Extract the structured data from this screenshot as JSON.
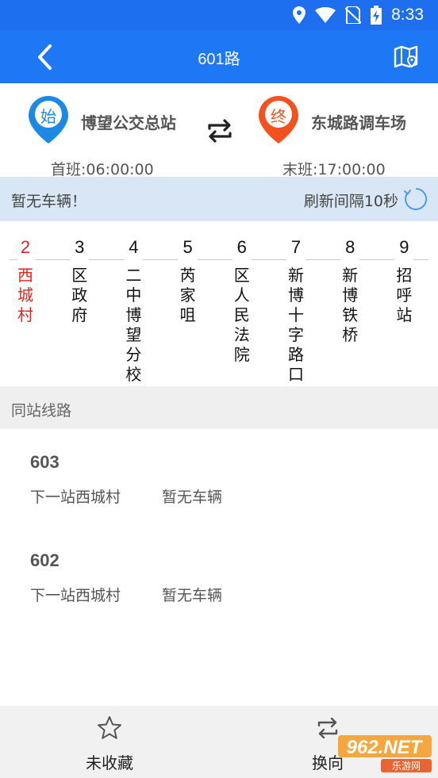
{
  "status_bar": {
    "time": "8:33",
    "icons": [
      "location-icon",
      "wifi-icon",
      "no-sim-icon",
      "battery-charging-icon"
    ]
  },
  "header": {
    "title": "601路",
    "back_icon": "chevron-left-icon",
    "map_icon": "map-icon"
  },
  "route": {
    "start": {
      "badge": "始",
      "name": "博望公交总站",
      "time": "首班:06:00:00",
      "color": "#1E88E5"
    },
    "end": {
      "badge": "终",
      "name": "东城路调车场",
      "time": "末班:17:00:00",
      "color": "#F4511E"
    },
    "swap_icon": "swap-icon"
  },
  "refresh": {
    "status": "暂无车辆！",
    "interval": "刷新间隔10秒",
    "icon": "refresh-icon"
  },
  "stations": [
    {
      "num": "2",
      "name": "西城村",
      "current": true
    },
    {
      "num": "3",
      "name": "区政府",
      "current": false
    },
    {
      "num": "4",
      "name": "二中博望分校",
      "current": false
    },
    {
      "num": "5",
      "name": "芮家咀",
      "current": false
    },
    {
      "num": "6",
      "name": "区人民法院",
      "current": false
    },
    {
      "num": "7",
      "name": "新博十字路口",
      "current": false
    },
    {
      "num": "8",
      "name": "新博铁桥",
      "current": false
    },
    {
      "num": "9",
      "name": "招呼站",
      "current": false
    }
  ],
  "same_station": {
    "title": "同站线路",
    "routes": [
      {
        "name": "603",
        "next": "下一站西城村",
        "status": "暂无车辆"
      },
      {
        "name": "602",
        "next": "下一站西城村",
        "status": "暂无车辆"
      }
    ]
  },
  "bottom": {
    "favorite_label": "未收藏",
    "reverse_label": "换向"
  },
  "watermark": {
    "text": "962.NET",
    "sub": "乐游网"
  },
  "colors": {
    "primary": "#1E78F5",
    "current_station": "#E5231C"
  }
}
